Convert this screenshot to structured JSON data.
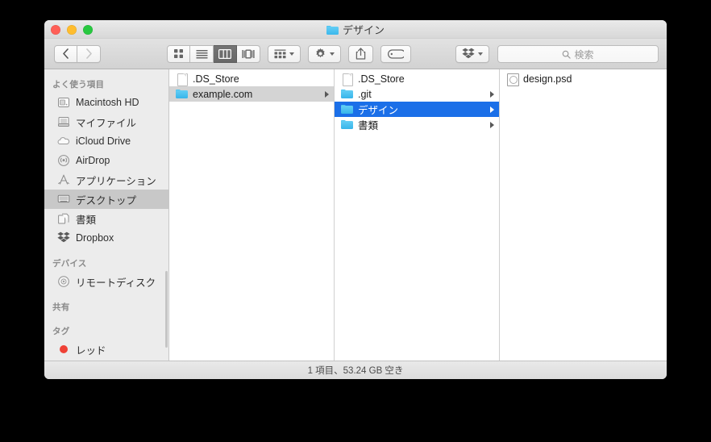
{
  "window": {
    "title": "デザイン",
    "title_icon": "folder-icon",
    "traffic_lights": {
      "close": "close-button",
      "minimize": "minimize-button",
      "zoom": "zoom-button",
      "close_color": "#ff5f57",
      "minimize_color": "#ffbd2e",
      "zoom_color": "#28c840"
    }
  },
  "toolbar": {
    "back_label": "‹",
    "forward_label": "›",
    "views": [
      {
        "name": "icon-view",
        "icon": "grid-icon",
        "active": false
      },
      {
        "name": "list-view",
        "icon": "list-icon",
        "active": false
      },
      {
        "name": "column-view",
        "icon": "columns-icon",
        "active": true
      },
      {
        "name": "gallery-view",
        "icon": "coverflow-icon",
        "active": false
      }
    ],
    "arrange": {
      "name": "arrange-button",
      "icon": "arrange-grid-icon"
    },
    "action": {
      "name": "action-button",
      "icon": "gear-icon"
    },
    "share": {
      "name": "share-button",
      "icon": "share-icon"
    },
    "tag": {
      "name": "tag-button",
      "icon": "tag-icon"
    },
    "dropbox": {
      "name": "dropbox-button",
      "icon": "dropbox-icon"
    }
  },
  "search": {
    "placeholder": "検索",
    "value": "",
    "icon": "search-icon"
  },
  "sidebar": {
    "sections": [
      {
        "header": "よく使う項目",
        "items": [
          {
            "label": "Macintosh HD",
            "icon": "harddisk-icon",
            "selected": false
          },
          {
            "label": "マイファイル",
            "icon": "myfiles-icon",
            "selected": false
          },
          {
            "label": "iCloud Drive",
            "icon": "cloud-icon",
            "selected": false
          },
          {
            "label": "AirDrop",
            "icon": "airdrop-icon",
            "selected": false
          },
          {
            "label": "アプリケーション",
            "icon": "applications-icon",
            "selected": false
          },
          {
            "label": "デスクトップ",
            "icon": "desktop-icon",
            "selected": true
          },
          {
            "label": "書類",
            "icon": "documents-icon",
            "selected": false
          },
          {
            "label": "Dropbox",
            "icon": "dropbox-icon",
            "selected": false
          }
        ]
      },
      {
        "header": "デバイス",
        "items": [
          {
            "label": "リモートディスク",
            "icon": "disc-icon",
            "selected": false
          }
        ]
      },
      {
        "header": "共有",
        "items": []
      },
      {
        "header": "タグ",
        "items": [
          {
            "label": "レッド",
            "icon": "tag-dot-icon",
            "color": "#ef4136",
            "selected": false
          }
        ]
      }
    ]
  },
  "columns": [
    {
      "name": "column-1",
      "rows": [
        {
          "label": ".DS_Store",
          "icon": "document-icon",
          "kind": "file",
          "selection": "none",
          "has_disclosure": false
        },
        {
          "label": "example.com",
          "icon": "folder-icon",
          "kind": "folder",
          "selection": "gray",
          "has_disclosure": true
        }
      ]
    },
    {
      "name": "column-2",
      "rows": [
        {
          "label": ".DS_Store",
          "icon": "document-icon",
          "kind": "file",
          "selection": "none",
          "has_disclosure": false
        },
        {
          "label": ".git",
          "icon": "folder-icon",
          "kind": "folder",
          "selection": "none",
          "has_disclosure": true
        },
        {
          "label": "デザイン",
          "icon": "folder-icon",
          "kind": "folder",
          "selection": "blue",
          "has_disclosure": true
        },
        {
          "label": "書類",
          "icon": "folder-icon",
          "kind": "folder",
          "selection": "none",
          "has_disclosure": true
        }
      ]
    },
    {
      "name": "column-3",
      "rows": [
        {
          "label": "design.psd",
          "icon": "psd-file-icon",
          "kind": "file",
          "selection": "none",
          "has_disclosure": false
        }
      ]
    }
  ],
  "statusbar": {
    "text": "1 項目、53.24 GB 空き"
  },
  "colors": {
    "selection_blue": "#1b6fe8",
    "selection_gray": "#d4d4d4",
    "folder_blue": "#4cc3f0",
    "window_chrome": "#ececec"
  }
}
